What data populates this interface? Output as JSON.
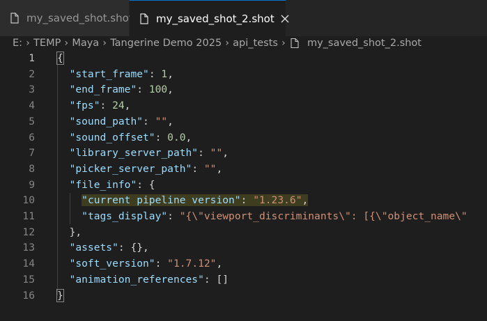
{
  "tabs": [
    {
      "label": "my_saved_shot.shot",
      "active": false,
      "icon": "file-icon"
    },
    {
      "label": "my_saved_shot_2.shot",
      "active": true,
      "icon": "file-icon",
      "close_icon": "close-icon"
    }
  ],
  "breadcrumb": [
    "E:",
    "TEMP",
    "Maya",
    "Tangerine Demo 2025",
    "api_tests",
    "my_saved_shot_2.shot"
  ],
  "editor": {
    "lines": [
      {
        "num": "1",
        "indent": "",
        "parts": [
          {
            "t": "{",
            "c": "p"
          }
        ]
      },
      {
        "num": "2",
        "indent": "  ",
        "parts": [
          {
            "t": "\"start_frame\"",
            "c": "k"
          },
          {
            "t": ": ",
            "c": "p"
          },
          {
            "t": "1",
            "c": "n"
          },
          {
            "t": ",",
            "c": "p"
          }
        ]
      },
      {
        "num": "3",
        "indent": "  ",
        "parts": [
          {
            "t": "\"end_frame\"",
            "c": "k"
          },
          {
            "t": ": ",
            "c": "p"
          },
          {
            "t": "100",
            "c": "n"
          },
          {
            "t": ",",
            "c": "p"
          }
        ]
      },
      {
        "num": "4",
        "indent": "  ",
        "parts": [
          {
            "t": "\"fps\"",
            "c": "k"
          },
          {
            "t": ": ",
            "c": "p"
          },
          {
            "t": "24",
            "c": "n"
          },
          {
            "t": ",",
            "c": "p"
          }
        ]
      },
      {
        "num": "5",
        "indent": "  ",
        "parts": [
          {
            "t": "\"sound_path\"",
            "c": "k"
          },
          {
            "t": ": ",
            "c": "p"
          },
          {
            "t": "\"\"",
            "c": "s"
          },
          {
            "t": ",",
            "c": "p"
          }
        ]
      },
      {
        "num": "6",
        "indent": "  ",
        "parts": [
          {
            "t": "\"sound_offset\"",
            "c": "k"
          },
          {
            "t": ": ",
            "c": "p"
          },
          {
            "t": "0.0",
            "c": "n"
          },
          {
            "t": ",",
            "c": "p"
          }
        ]
      },
      {
        "num": "7",
        "indent": "  ",
        "parts": [
          {
            "t": "\"library_server_path\"",
            "c": "k"
          },
          {
            "t": ": ",
            "c": "p"
          },
          {
            "t": "\"\"",
            "c": "s"
          },
          {
            "t": ",",
            "c": "p"
          }
        ]
      },
      {
        "num": "8",
        "indent": "  ",
        "parts": [
          {
            "t": "\"picker_server_path\"",
            "c": "k"
          },
          {
            "t": ": ",
            "c": "p"
          },
          {
            "t": "\"\"",
            "c": "s"
          },
          {
            "t": ",",
            "c": "p"
          }
        ]
      },
      {
        "num": "9",
        "indent": "  ",
        "parts": [
          {
            "t": "\"file_info\"",
            "c": "k"
          },
          {
            "t": ": {",
            "c": "p"
          }
        ]
      },
      {
        "num": "10",
        "indent": "    ",
        "highlight": true,
        "parts": [
          {
            "t": "\"current pipeline version\"",
            "c": "k"
          },
          {
            "t": ": ",
            "c": "p"
          },
          {
            "t": "\"1.23.6\"",
            "c": "s"
          },
          {
            "t": ",",
            "c": "p"
          }
        ]
      },
      {
        "num": "11",
        "indent": "    ",
        "parts": [
          {
            "t": "\"tags_display\"",
            "c": "k"
          },
          {
            "t": ": ",
            "c": "p"
          },
          {
            "t": "\"{\\\"viewport_discriminants\\\": [{\\\"object_name\\\"",
            "c": "s"
          }
        ]
      },
      {
        "num": "12",
        "indent": "  ",
        "parts": [
          {
            "t": "},",
            "c": "p"
          }
        ]
      },
      {
        "num": "13",
        "indent": "  ",
        "parts": [
          {
            "t": "\"assets\"",
            "c": "k"
          },
          {
            "t": ": {},",
            "c": "p"
          }
        ]
      },
      {
        "num": "14",
        "indent": "  ",
        "parts": [
          {
            "t": "\"soft_version\"",
            "c": "k"
          },
          {
            "t": ": ",
            "c": "p"
          },
          {
            "t": "\"1.7.12\"",
            "c": "s"
          },
          {
            "t": ",",
            "c": "p"
          }
        ]
      },
      {
        "num": "15",
        "indent": "  ",
        "parts": [
          {
            "t": "\"animation_references\"",
            "c": "k"
          },
          {
            "t": ": []",
            "c": "p"
          }
        ]
      },
      {
        "num": "16",
        "indent": "",
        "parts": [
          {
            "t": "}",
            "c": "p"
          }
        ]
      }
    ],
    "current_line": "1"
  },
  "colors": {
    "background": "#1e1e1e",
    "key": "#9cdcfe",
    "string": "#ce9178",
    "number": "#b5cea8",
    "punctuation": "#d4d4d4",
    "line_number": "#858585",
    "active_tab_border": "#0078d4",
    "line_highlight": "#3f3d1f"
  }
}
